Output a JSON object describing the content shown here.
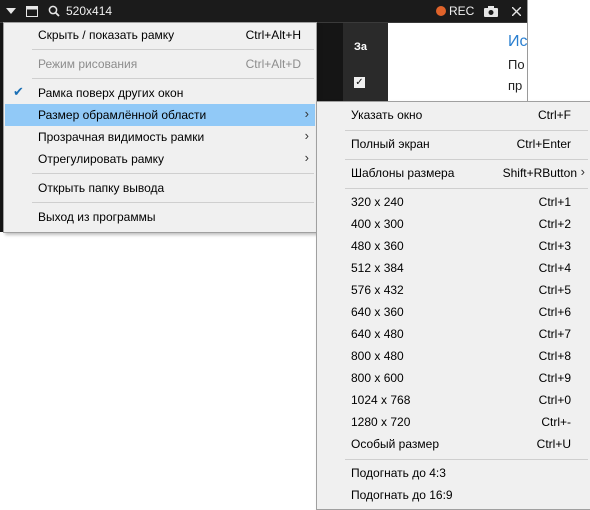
{
  "toolbar": {
    "size_label": "520x414",
    "rec_label": "REC",
    "colors": {
      "background": "#1b1b1b",
      "rec_dot": "#e0632a"
    }
  },
  "background": {
    "dark_heading": "За",
    "right_heading": "Ис",
    "right_text_1": "По",
    "right_text_2": "пр"
  },
  "main_menu": {
    "items": [
      {
        "label": "Скрыть / показать рамку",
        "shortcut": "Ctrl+Alt+H"
      },
      {
        "label": "Режим рисования",
        "shortcut": "Ctrl+Alt+D"
      },
      {
        "label": "Рамка поверх других окон"
      },
      {
        "label": "Размер обрамлённой области"
      },
      {
        "label": "Прозрачная видимость рамки"
      },
      {
        "label": "Отрегулировать рамку"
      },
      {
        "label": "Открыть папку вывода"
      },
      {
        "label": "Выход из программы"
      }
    ]
  },
  "sub_menu": {
    "items": [
      {
        "label": "Указать окно",
        "shortcut": "Ctrl+F"
      },
      {
        "label": "Полный экран",
        "shortcut": "Ctrl+Enter"
      },
      {
        "label": "Шаблоны размера",
        "shortcut": "Shift+RButton"
      },
      {
        "label": "320 x 240",
        "shortcut": "Ctrl+1"
      },
      {
        "label": "400 x 300",
        "shortcut": "Ctrl+2"
      },
      {
        "label": "480 x 360",
        "shortcut": "Ctrl+3"
      },
      {
        "label": "512 x 384",
        "shortcut": "Ctrl+4"
      },
      {
        "label": "576 x 432",
        "shortcut": "Ctrl+5"
      },
      {
        "label": "640 x 360",
        "shortcut": "Ctrl+6"
      },
      {
        "label": "640 x 480",
        "shortcut": "Ctrl+7"
      },
      {
        "label": "800 x 480",
        "shortcut": "Ctrl+8"
      },
      {
        "label": "800 x 600",
        "shortcut": "Ctrl+9"
      },
      {
        "label": "1024 x 768",
        "shortcut": "Ctrl+0"
      },
      {
        "label": "1280 x 720",
        "shortcut": "Ctrl+-"
      },
      {
        "label": "Особый размер",
        "shortcut": "Ctrl+U"
      },
      {
        "label": "Подогнать до 4:3"
      },
      {
        "label": "Подогнать до 16:9"
      }
    ]
  },
  "colors": {
    "menu_bg": "#f0f0f0",
    "highlight": "#91c9f7",
    "disabled_text": "#8d8d8d",
    "check": "#1a6fb5"
  }
}
